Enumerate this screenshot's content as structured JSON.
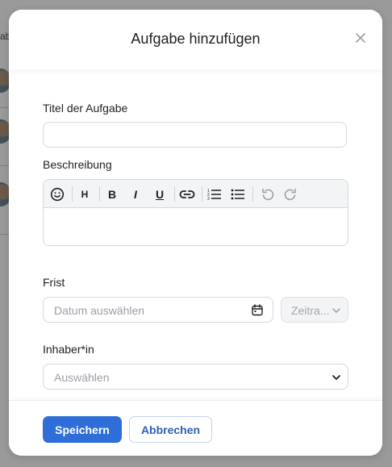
{
  "background": {
    "tab_fragment": "ab"
  },
  "modal": {
    "title": "Aufgabe hinzufügen",
    "close_icon": "close-icon"
  },
  "form": {
    "title_label": "Titel der Aufgabe",
    "title_value": "",
    "description_label": "Beschreibung",
    "description_value": "",
    "toolbar": [
      {
        "name": "emoji",
        "icon": "smiley-icon"
      },
      {
        "name": "heading",
        "text": "H"
      },
      {
        "name": "bold",
        "text": "B"
      },
      {
        "name": "italic",
        "text": "I"
      },
      {
        "name": "underline",
        "text": "U"
      },
      {
        "name": "link",
        "icon": "link-icon"
      },
      {
        "name": "ordered-list",
        "icon": "numbered-list-icon"
      },
      {
        "name": "bullet-list",
        "icon": "bullet-list-icon"
      },
      {
        "name": "undo",
        "icon": "undo-icon"
      },
      {
        "name": "redo",
        "icon": "redo-icon"
      }
    ],
    "deadline_label": "Frist",
    "date_placeholder": "Datum auswählen",
    "time_placeholder": "Zeitra...",
    "owner_label": "Inhaber*in",
    "owner_placeholder": "Auswählen"
  },
  "footer": {
    "save_label": "Speichern",
    "cancel_label": "Abbrechen"
  },
  "colors": {
    "primary": "#2f6ed8",
    "secondary_text": "#2f5fb3",
    "border": "#d5d8dc",
    "toolbar_bg": "#f3f4f5"
  }
}
